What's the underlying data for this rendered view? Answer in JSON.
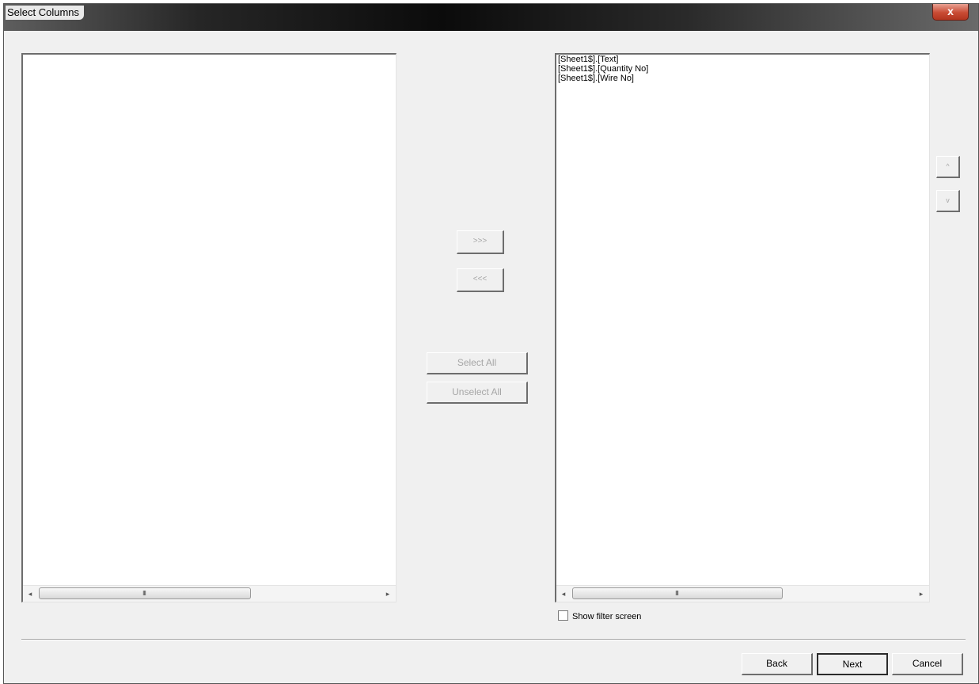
{
  "window": {
    "title": "Select Columns",
    "close_label": "x"
  },
  "available_list": {
    "items": []
  },
  "selected_list": {
    "items": [
      "[Sheet1$].[Text]",
      "[Sheet1$].[Quantity No]",
      "[Sheet1$].[Wire No]"
    ]
  },
  "transfer": {
    "move_right_label": ">>>",
    "move_left_label": "<<<",
    "select_all_label": "Select All",
    "unselect_all_label": "Unselect All"
  },
  "order": {
    "up_label": "^",
    "down_label": "v"
  },
  "scrollbar": {
    "left_arrow": "◂",
    "right_arrow": "▸",
    "grip": "III"
  },
  "filter": {
    "label": "Show filter screen",
    "checked": false
  },
  "footer": {
    "back_label": "Back",
    "next_label": "Next",
    "cancel_label": "Cancel"
  },
  "colors": {
    "window_bg": "#f0f0f0",
    "disabled_text": "#a6a6a6",
    "close_button": "#c94b34"
  }
}
